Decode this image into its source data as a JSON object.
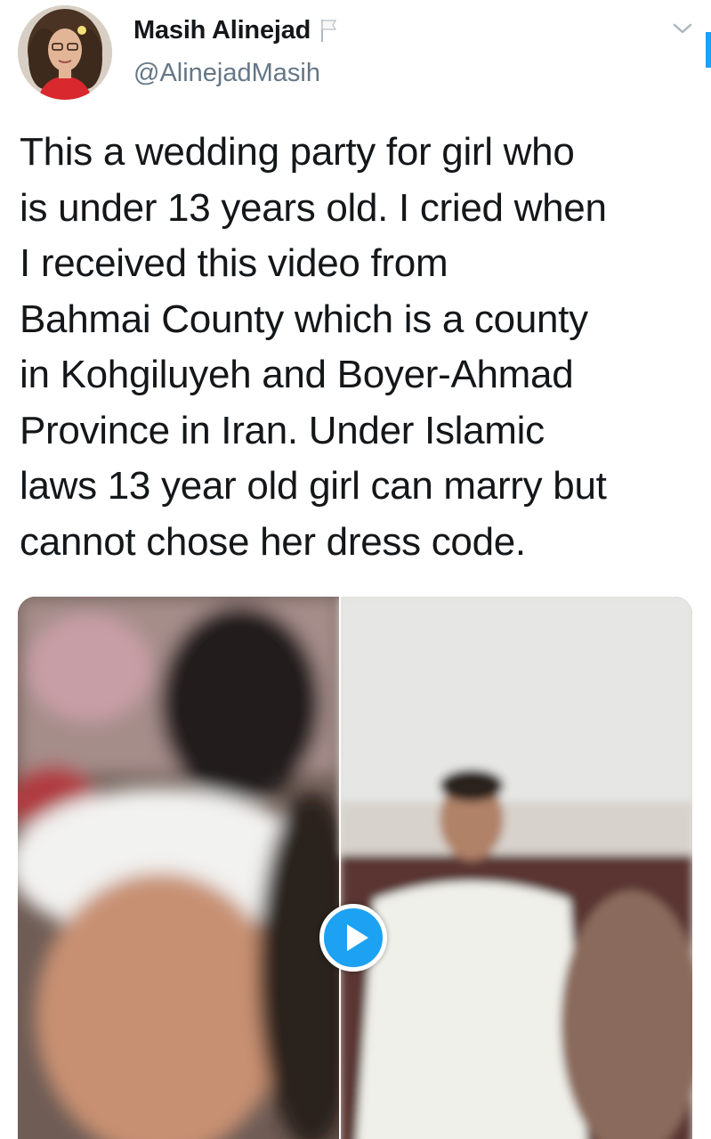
{
  "author": {
    "display_name": "Masih Alinejad",
    "handle": "@AlinejadMasih",
    "avatar_icon": "profile-photo",
    "badge_icon": "white-flag-icon"
  },
  "tweet": {
    "text": "This a wedding party for girl who\nis under 13 years old. I cried when\nI received this video from\nBahmai County which is a county\nin Kohgiluyeh and Boyer-Ahmad\nProvince in Iran.  Under Islamic\nlaws 13 year old girl can marry but\ncannot chose her dress code."
  },
  "media": {
    "type": "video",
    "play_icon": "play-icon"
  },
  "menu": {
    "icon": "chevron-down-icon"
  },
  "colors": {
    "accent": "#1da1f2",
    "text_primary": "#14171a",
    "text_secondary": "#657786"
  }
}
